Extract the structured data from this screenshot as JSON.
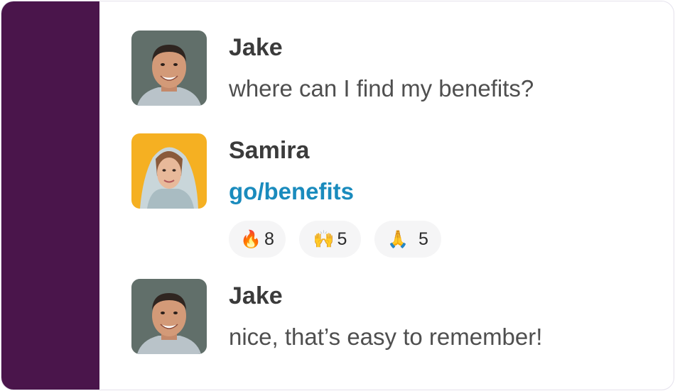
{
  "messages": [
    {
      "author": "Jake",
      "text": "where can I find my benefits?",
      "avatar": "jake-avatar"
    },
    {
      "author": "Samira",
      "link_text": "go/benefits",
      "avatar": "samira-avatar"
    },
    {
      "author": "Jake",
      "text": "nice, that’s easy to remember!",
      "avatar": "jake-avatar"
    }
  ],
  "reactions": [
    {
      "emoji": "🔥",
      "icon": "fire-icon",
      "count": "8"
    },
    {
      "emoji": "🙌",
      "icon": "raised-hands-icon",
      "count": "5"
    },
    {
      "emoji": "🙏",
      "icon": "folded-hands-icon",
      "count": "5"
    }
  ],
  "colors": {
    "sidebar": "#4a154b",
    "link": "#1a8bbd",
    "jake_avatar_bg": "#5d6b66",
    "samira_avatar_bg": "#f5b022",
    "reaction_bg": "#f5f5f6"
  }
}
